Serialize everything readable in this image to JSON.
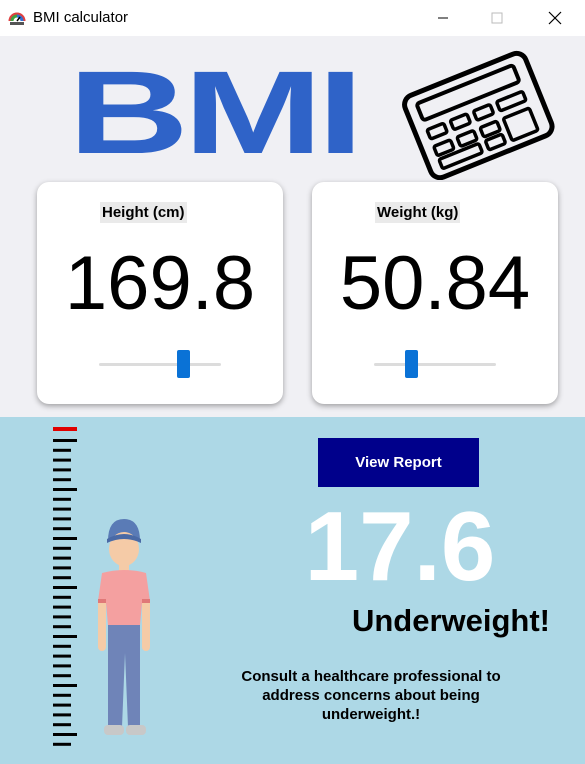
{
  "window": {
    "title": "BMI calculator"
  },
  "header": {
    "logo_text": "BMI"
  },
  "height_card": {
    "label": "Height (cm)",
    "value": "169.8",
    "slider_fraction": 0.72
  },
  "weight_card": {
    "label": "Weight (kg)",
    "value": "50.84",
    "slider_fraction": 0.28
  },
  "result": {
    "report_button": "View Report",
    "bmi": "17.6",
    "status": "Underweight!",
    "advice": "Consult a healthcare professional to address concerns about being underweight.!"
  },
  "colors": {
    "logo_blue": "#2f63c8",
    "slider_blue": "#0a72d6",
    "report_button_bg": "#00008b",
    "result_panel_bg": "#add8e6",
    "ruler_marker_red": "#e00000"
  },
  "icons": [
    "app-icon",
    "minimize-icon",
    "maximize-icon",
    "close-icon",
    "calculator-icon",
    "ruler-icon",
    "person-icon"
  ]
}
